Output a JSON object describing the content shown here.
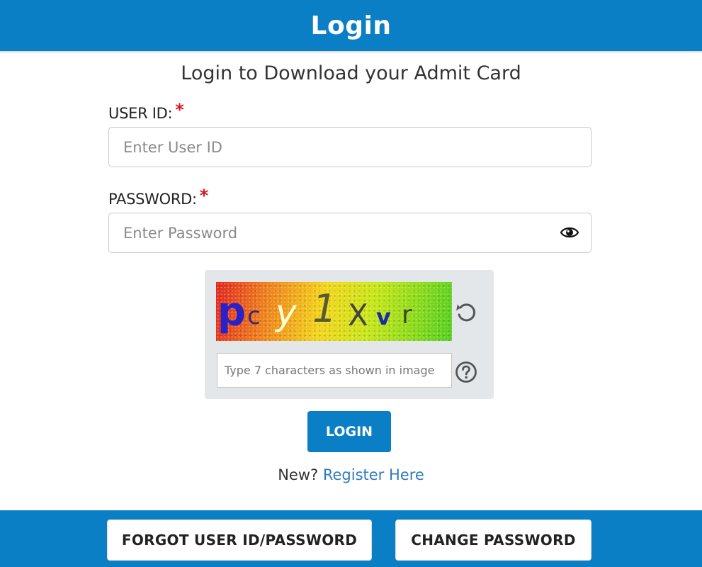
{
  "header": {
    "title": "Login"
  },
  "form": {
    "subtitle": "Login to Download your Admit Card",
    "user_id": {
      "label": "USER ID:",
      "required_mark": "*",
      "placeholder": "Enter User ID",
      "value": ""
    },
    "password": {
      "label": "PASSWORD:",
      "required_mark": "*",
      "placeholder": "Enter Password",
      "value": "",
      "toggle_icon": "eye-icon"
    }
  },
  "captcha": {
    "characters": [
      "p",
      "c",
      "y",
      "1",
      "X",
      "v",
      "r"
    ],
    "input_placeholder": "Type 7 characters as shown in image",
    "refresh_icon": "refresh-icon",
    "help_icon": "question-circle-icon"
  },
  "actions": {
    "login_label": "LOGIN",
    "register_prefix": "New?",
    "register_link": "Register Here"
  },
  "footer": {
    "forgot_label": "FORGOT USER ID/PASSWORD",
    "change_label": "CHANGE PASSWORD"
  },
  "colors": {
    "brand_blue": "#0b7fc6",
    "required_red": "#d9141b",
    "link_blue": "#2f7bbd"
  }
}
